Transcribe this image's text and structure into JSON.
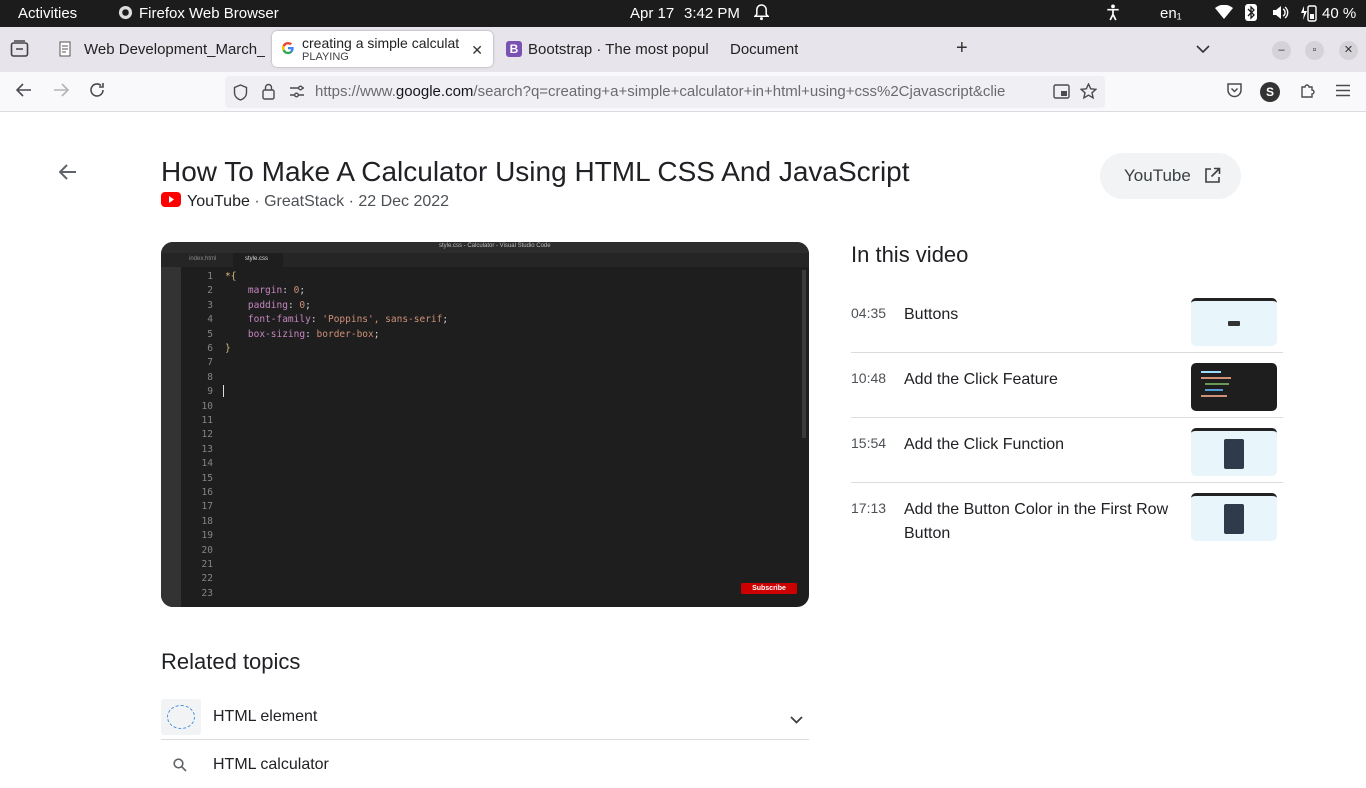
{
  "system_bar": {
    "activities": "Activities",
    "app_name": "Firefox Web Browser",
    "date": "Apr 17",
    "time": "3:42 PM",
    "language": "en₁",
    "battery": "40 %"
  },
  "tabs": [
    {
      "label": "Web Development_March_",
      "active": false
    },
    {
      "label": "creating a simple calculat",
      "sublabel": "PLAYING",
      "active": true
    },
    {
      "label": "Bootstrap · The most popul",
      "active": false
    },
    {
      "label": "Document",
      "active": false
    }
  ],
  "address_bar": {
    "url_prefix": "https://www.",
    "url_domain": "google.com",
    "url_path": "/search?q=creating+a+simple+calculator+in+html+using+css%2Cjavascript&clie"
  },
  "profile_initial": "S",
  "video": {
    "title": "How To Make A Calculator Using HTML CSS And JavaScript",
    "source": "YouTube",
    "meta": " · GreatStack · 22 Dec 2022",
    "open_button": "YouTube"
  },
  "editor": {
    "window_title": "style.css - Calculator - Visual Studio Code",
    "tab1": "index.html",
    "tab2": "style.css",
    "subscribe": "Subscribe",
    "lines": [
      "*{",
      "    margin: 0;",
      "    padding: 0;",
      "    font-family: 'Poppins', sans-serif;",
      "    box-sizing: border-box;",
      "}",
      "",
      "",
      "",
      "",
      "",
      "",
      "",
      "",
      "",
      "",
      "",
      "",
      "",
      "",
      "",
      "",
      ""
    ],
    "line_numbers": [
      "1",
      "2",
      "3",
      "4",
      "5",
      "6",
      "7",
      "8",
      "9",
      "10",
      "11",
      "12",
      "13",
      "14",
      "15",
      "16",
      "17",
      "18",
      "19",
      "20",
      "21",
      "22",
      "23"
    ]
  },
  "in_this_video": {
    "heading": "In this video",
    "chapters": [
      {
        "time": "04:35",
        "title": "Buttons"
      },
      {
        "time": "10:48",
        "title": "Add the Click Feature"
      },
      {
        "time": "15:54",
        "title": "Add the Click Function"
      },
      {
        "time": "17:13",
        "title": "Add the Button Color in the First Row Button"
      }
    ]
  },
  "related": {
    "heading": "Related topics",
    "items": [
      {
        "label": "HTML element"
      },
      {
        "label": "HTML calculator"
      }
    ]
  },
  "colors": {
    "youtube_red": "#ff0000",
    "topbar": "#1c1c1c",
    "tabbar": "#e7e5eb",
    "editor_bg": "#1e1e1e"
  }
}
